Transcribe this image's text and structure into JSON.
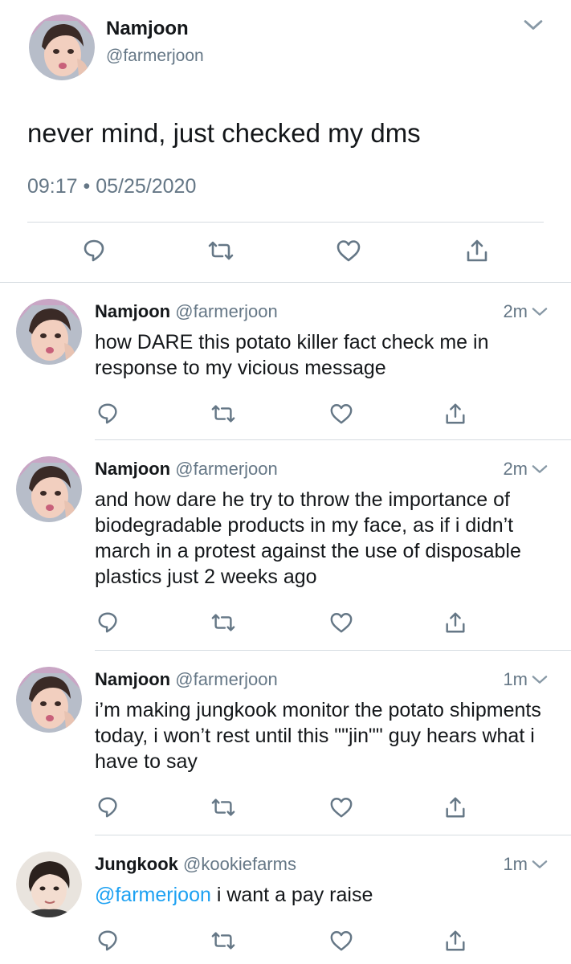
{
  "main_tweet": {
    "name": "Namjoon",
    "handle": "@farmerjoon",
    "text": "never mind, just checked my dms",
    "time": "09:17",
    "separator": "•",
    "date": "05/25/2020"
  },
  "replies": [
    {
      "name": "Namjoon",
      "handle": "@farmerjoon",
      "time": "2m",
      "text": "how DARE this potato killer fact check me in response to my vicious message"
    },
    {
      "name": "Namjoon",
      "handle": "@farmerjoon",
      "time": "2m",
      "text": "and how dare he try to throw the importance of biodegradable products in my face, as if i didn’t march in a protest against the use of disposable plastics just 2 weeks ago"
    },
    {
      "name": "Namjoon",
      "handle": "@farmerjoon",
      "time": "1m",
      "text": "i’m making jungkook monitor the potato shipments today, i won’t rest until this \"\"jin\"\" guy hears what i have to say"
    },
    {
      "name": "Jungkook",
      "handle": "@kookiefarms",
      "time": "1m",
      "mention": "@farmerjoon",
      "text": " i want a pay raise"
    }
  ],
  "colors": {
    "accent": "#1da1f2",
    "muted": "#657786",
    "divider": "#d6dce1"
  },
  "icons": [
    "reply-icon",
    "retweet-icon",
    "like-icon",
    "share-icon",
    "chevron-down-icon"
  ]
}
